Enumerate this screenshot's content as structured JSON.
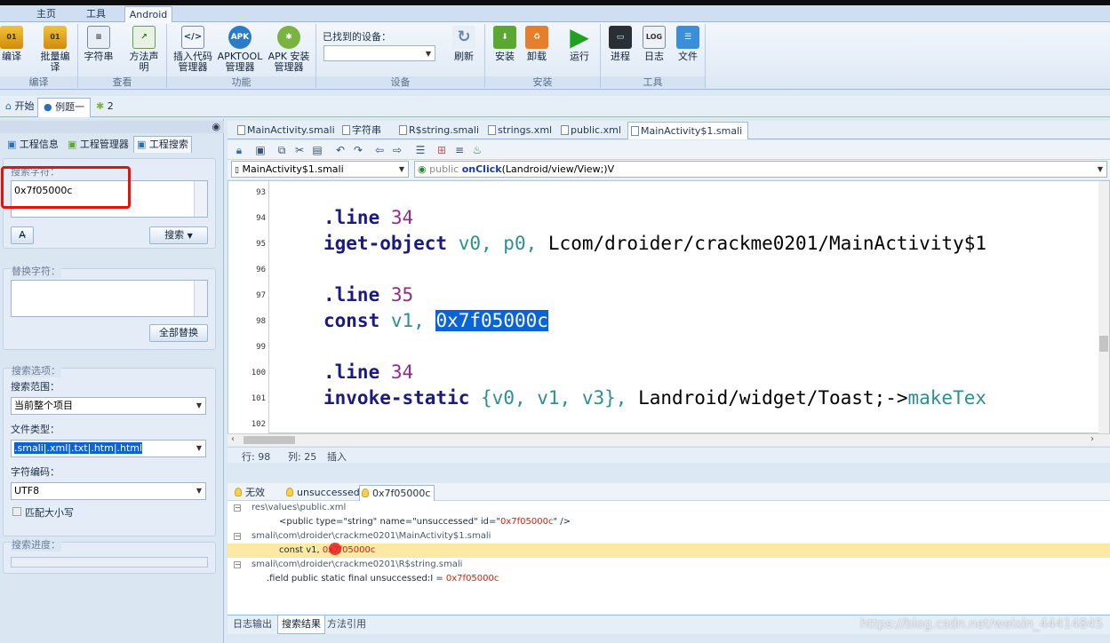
{
  "ribbon_tabs": [
    "主页",
    "工具",
    "Android"
  ],
  "ribbon_active_tab": "Android",
  "ribbon": {
    "groups": [
      {
        "label": "编译",
        "buttons": [
          {
            "label": "编译"
          },
          {
            "label": "批量编译"
          }
        ]
      },
      {
        "label": "查看",
        "buttons": [
          {
            "label": "字符串"
          },
          {
            "label": "方法声明"
          }
        ]
      },
      {
        "label": "功能",
        "buttons": [
          {
            "label": "插入代码管理器"
          },
          {
            "label": "APKTOOL管理器"
          },
          {
            "label": "APK 安装管理器"
          }
        ]
      },
      {
        "label": "设备",
        "device_label": "已找到的设备：",
        "refresh": "刷新"
      },
      {
        "label": "安装",
        "buttons": [
          {
            "label": "安装"
          },
          {
            "label": "卸载"
          },
          {
            "label": "运行"
          }
        ]
      },
      {
        "label": "工具",
        "buttons": [
          {
            "label": "进程"
          },
          {
            "label": "日志"
          },
          {
            "label": "文件"
          }
        ]
      }
    ]
  },
  "doc_tabs": [
    {
      "label": "开始"
    },
    {
      "label": "例题一"
    },
    {
      "label": "2"
    }
  ],
  "left_panel": {
    "tabs": [
      "工程信息",
      "工程管理器",
      "工程搜索"
    ],
    "search_label": "搜索字符：",
    "search_value": "0x7f05000c",
    "search_button": "搜索",
    "replace_label": "替换字符：",
    "replace_all_button": "全部替换",
    "options_label": "搜索选项：",
    "scope_label": "搜索范围：",
    "scope_value": "当前整个项目",
    "filetype_label": "文件类型：",
    "filetype_value": ".smali|.xml|.txt|.htm|.html",
    "encoding_label": "字符编码：",
    "encoding_value": "UTF8",
    "match_case": "匹配大小写",
    "progress_label": "搜索进度："
  },
  "editor_tabs": [
    {
      "label": "MainActivity.smali"
    },
    {
      "label": "字符串"
    },
    {
      "label": "R$string.smali"
    },
    {
      "label": "strings.xml"
    },
    {
      "label": "public.xml"
    },
    {
      "label": "MainActivity$1.smali"
    }
  ],
  "editor_file_combo": "MainActivity$1.smali",
  "editor_method_combo": {
    "prefix": "public",
    "name": "onClick",
    "sig": "(Landroid/view/View;)V"
  },
  "code_lines": [
    {
      "n": "93"
    },
    {
      "n": "94",
      "directive": ".line",
      "num": "34"
    },
    {
      "n": "95",
      "op": "iget-object",
      "args": "v0, p0,",
      "rest": "Lcom/droider/crackme0201/MainActivity$1"
    },
    {
      "n": "96"
    },
    {
      "n": "97",
      "directive": ".line",
      "num": "35"
    },
    {
      "n": "98",
      "op": "const",
      "args": "v1,",
      "selected": "0x7f05000c"
    },
    {
      "n": "99"
    },
    {
      "n": "100",
      "directive": ".line",
      "num": "34"
    },
    {
      "n": "101",
      "op": "invoke-static",
      "args": "{v0, v1, v3},",
      "rest": "Landroid/widget/Toast;->",
      "rest2": "makeTex"
    },
    {
      "n": "102"
    }
  ],
  "status": {
    "row": "行: 98",
    "col": "列: 25",
    "mode": "插入"
  },
  "results_tabs": [
    "无效",
    "unsuccessed",
    "0x7f05000c"
  ],
  "results": [
    {
      "path": "res\\values\\public.xml"
    },
    {
      "pre": "<public type=\"string\" name=\"unsuccessed\" id=\"",
      "match": "0x7f05000c",
      "post": "\" />"
    },
    {
      "path": "smali\\com\\droider\\crackme0201\\MainActivity$1.smali"
    },
    {
      "pre": "const v1, ",
      "match": "0x7f05000c",
      "post": ""
    },
    {
      "path": "smali\\com\\droider\\crackme0201\\R$string.smali"
    },
    {
      "pre": ".field public static final unsuccessed:I = ",
      "match": "0x7f05000c",
      "post": ""
    }
  ],
  "bottom_tabs": [
    "日志输出",
    "搜索结果",
    "方法引用"
  ],
  "watermark": "https://blog.csdn.net/weixin_44414845"
}
